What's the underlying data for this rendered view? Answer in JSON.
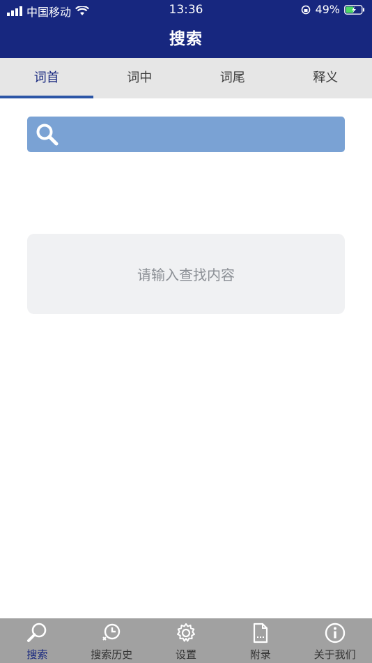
{
  "status_bar": {
    "carrier": "中国移动",
    "time": "13:36",
    "battery": "49%"
  },
  "header": {
    "title": "搜索"
  },
  "tabs": [
    {
      "label": "词首",
      "active": true
    },
    {
      "label": "词中",
      "active": false
    },
    {
      "label": "词尾",
      "active": false
    },
    {
      "label": "释义",
      "active": false
    }
  ],
  "search": {
    "value": "",
    "placeholder": ""
  },
  "hint": {
    "text": "请输入查找内容"
  },
  "tabbar": [
    {
      "label": "搜索",
      "icon": "search-icon",
      "active": true
    },
    {
      "label": "搜索历史",
      "icon": "history-icon",
      "active": false
    },
    {
      "label": "设置",
      "icon": "gear-icon",
      "active": false
    },
    {
      "label": "附录",
      "icon": "document-icon",
      "active": false
    },
    {
      "label": "关于我们",
      "icon": "info-icon",
      "active": false
    }
  ],
  "colors": {
    "header": "#17277f",
    "tab_active": "#17277f",
    "tab_indicator": "#2c56a6",
    "search_bg": "#7aa2d4",
    "tabbar_bg": "#a1a1a1"
  }
}
